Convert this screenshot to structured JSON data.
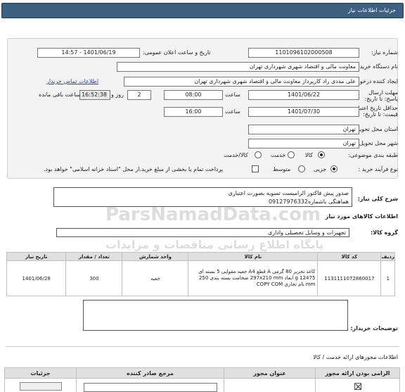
{
  "header": {
    "title": "جزئیات اطلاعات نیاز"
  },
  "form": {
    "need_number_label": "شماره نیاز:",
    "need_number": "1101096102000508",
    "announce_label": "تاریخ و ساعت اعلان عمومی:",
    "announce_value": "1401/06/19 - 14:57",
    "buyer_org_label": "نام دستگاه خریدار:",
    "buyer_org": "معاونت مالی و اقتصاد شهری شهرداری تهران",
    "creator_label": "ایجاد کننده درخواست:",
    "creator": "علی مددی راد کارپرداز معاونت مالی و اقتصاد شهری شهرداری تهران",
    "contact_link": "اطلاعات تماس خریدار",
    "deadline_label": "مهلت ارسال پاسخ: تا تاریخ:",
    "deadline_date": "1401/06/22",
    "time_label": "ساعت",
    "deadline_time": "08:00",
    "days_value": "2",
    "days_label": "روز و",
    "remaining_time": "16:52:38",
    "remaining_label": "ساعت باقی مانده",
    "validity_label": "حداقل تاریخ اعتبار قیمت: تا تاریخ:",
    "validity_date": "1401/07/30",
    "validity_time": "16:00",
    "province_label": "استان محل تحویل:",
    "province": "تهران",
    "city_label": "شهر محل تحویل:",
    "city": "تهران",
    "category_label": "طبقه بندی موضوعی:",
    "category_options": [
      "کالا",
      "خدمت",
      "کالا/خدمت"
    ],
    "process_label": "نوع فرآیند خرید :",
    "process_options": [
      "جزیی",
      "متوسط"
    ],
    "payment_note": "پرداخت تمام یا بخشی از مبلغ خرید،از محل \"اسناد خزانه اسلامی\" خواهد بود."
  },
  "summary": {
    "label": "شرح کلی نیاز:",
    "line1": "صدور پیش فاکتور الزامیست  تسویه بصورت اعتباری",
    "line2": "هماهنگی باشماره09127976332"
  },
  "goods": {
    "section_title": "اطلاعات کالاهای مورد نیاز",
    "group_label": "گروه کالا:",
    "group_value": "تجهیزات و وسایل تحصیلی واداری",
    "columns": [
      "ردیف",
      "کد کالا",
      "نام کالا",
      "واحد شمارش",
      "تعداد / مقدار",
      "تاریخ نیاز"
    ],
    "rows": [
      {
        "index": "1",
        "code": "1131111072860017",
        "name": "کاغذ تحریر 80 گرمی A قطع A4 جعبه مقوایی 5 بسته ای 12475 g ابعاد 297x210 mm ضخامت بسته بندی 250 mm نام تجاری COPY COM",
        "unit": "جعبه",
        "qty": "300",
        "date": "1401/06/28"
      }
    ]
  },
  "buyer_notes": {
    "label": "توضیحات خریدار:"
  },
  "permits": {
    "section_title": "اطلاعات مجوزهای ارائه خدمت / کالا",
    "columns": [
      "الزامی بودن ارائه مجوز",
      "عنوان مجوز",
      "مرجع صادر کننده",
      "جزئیات"
    ]
  },
  "watermark": {
    "line1": "ParsNamadData.com",
    "line2": "پایگاه اطلاع رسانی مناقصات و مزایدات"
  }
}
